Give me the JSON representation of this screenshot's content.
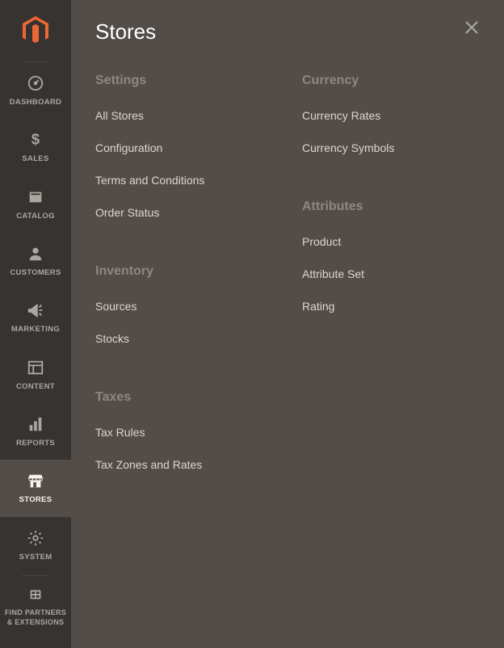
{
  "sidebar": {
    "items": [
      {
        "label": "DASHBOARD"
      },
      {
        "label": "SALES"
      },
      {
        "label": "CATALOG"
      },
      {
        "label": "CUSTOMERS"
      },
      {
        "label": "MARKETING"
      },
      {
        "label": "CONTENT"
      },
      {
        "label": "REPORTS"
      },
      {
        "label": "STORES"
      },
      {
        "label": "SYSTEM"
      },
      {
        "label": "FIND PARTNERS & EXTENSIONS"
      }
    ]
  },
  "panel": {
    "title": "Stores",
    "col1": {
      "settings": {
        "title": "Settings",
        "links": [
          "All Stores",
          "Configuration",
          "Terms and Conditions",
          "Order Status"
        ]
      },
      "inventory": {
        "title": "Inventory",
        "links": [
          "Sources",
          "Stocks"
        ]
      },
      "taxes": {
        "title": "Taxes",
        "links": [
          "Tax Rules",
          "Tax Zones and Rates"
        ]
      }
    },
    "col2": {
      "currency": {
        "title": "Currency",
        "links": [
          "Currency Rates",
          "Currency Symbols"
        ]
      },
      "attributes": {
        "title": "Attributes",
        "links": [
          "Product",
          "Attribute Set",
          "Rating"
        ]
      }
    }
  }
}
